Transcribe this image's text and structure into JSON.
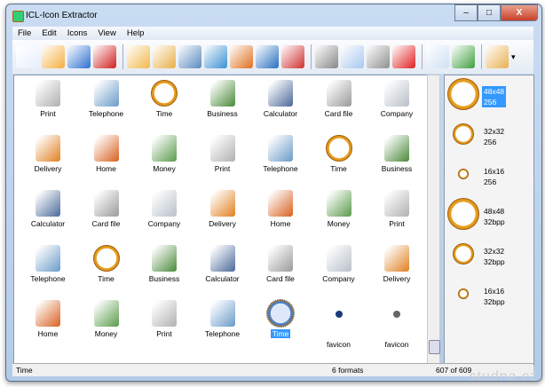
{
  "window": {
    "title": "ICL-Icon Extractor",
    "minimize": "–",
    "maximize": "□",
    "close": "X"
  },
  "menu": [
    "File",
    "Edit",
    "Icons",
    "View",
    "Help"
  ],
  "toolbar": [
    {
      "name": "new-icon",
      "color": "#e8f0fc"
    },
    {
      "name": "open-folder-icon",
      "color": "#f5b040"
    },
    {
      "name": "save-icon",
      "color": "#2f6fd0"
    },
    {
      "name": "save-ico-icon",
      "color": "#d02020"
    },
    "sep",
    {
      "name": "add-folder-icon",
      "color": "#f2b84a"
    },
    {
      "name": "search-folder-icon",
      "color": "#e8b048"
    },
    {
      "name": "search-screen-icon",
      "color": "#5a8ac0"
    },
    {
      "name": "web-search-icon",
      "color": "#3a90d0"
    },
    {
      "name": "extract-image-icon",
      "color": "#e07020"
    },
    {
      "name": "cubes-icon",
      "color": "#2a70c0"
    },
    {
      "name": "delete-image-icon",
      "color": "#d03030"
    },
    "sep",
    {
      "name": "cut-icon",
      "color": "#888888"
    },
    {
      "name": "copy-icon",
      "color": "#a8c8f0"
    },
    {
      "name": "paste-icon",
      "color": "#909090"
    },
    {
      "name": "delete-icon",
      "color": "#e02020"
    },
    "sep",
    {
      "name": "properties-icon",
      "color": "#d0e0f4"
    },
    {
      "name": "windows-icon",
      "color": "#40a040"
    },
    "sep",
    {
      "name": "resize-icon",
      "color": "#e8b050"
    }
  ],
  "icons": [
    {
      "label": "Print",
      "type": "print"
    },
    {
      "label": "Telephone",
      "type": "phone"
    },
    {
      "label": "Time",
      "type": "clock"
    },
    {
      "label": "Business",
      "type": "business"
    },
    {
      "label": "Calculator",
      "type": "calc"
    },
    {
      "label": "Card file",
      "type": "card"
    },
    {
      "label": "Company",
      "type": "company"
    },
    {
      "label": "Delivery",
      "type": "truck"
    },
    {
      "label": "Home",
      "type": "home"
    },
    {
      "label": "Money",
      "type": "money"
    },
    {
      "label": "Print",
      "type": "print"
    },
    {
      "label": "Telephone",
      "type": "phone"
    },
    {
      "label": "Time",
      "type": "clock"
    },
    {
      "label": "Business",
      "type": "business"
    },
    {
      "label": "Calculator",
      "type": "calc"
    },
    {
      "label": "Card file",
      "type": "card"
    },
    {
      "label": "Company",
      "type": "company"
    },
    {
      "label": "Delivery",
      "type": "truck"
    },
    {
      "label": "Home",
      "type": "home"
    },
    {
      "label": "Money",
      "type": "money"
    },
    {
      "label": "Print",
      "type": "print"
    },
    {
      "label": "Telephone",
      "type": "phone"
    },
    {
      "label": "Time",
      "type": "clock"
    },
    {
      "label": "Business",
      "type": "business"
    },
    {
      "label": "Calculator",
      "type": "calc"
    },
    {
      "label": "Card file",
      "type": "card"
    },
    {
      "label": "Company",
      "type": "company"
    },
    {
      "label": "Delivery",
      "type": "truck"
    },
    {
      "label": "Home",
      "type": "home"
    },
    {
      "label": "Money",
      "type": "money"
    },
    {
      "label": "Print",
      "type": "print"
    },
    {
      "label": "Telephone",
      "type": "phone"
    },
    {
      "label": "Time",
      "type": "clock",
      "selected": true
    },
    {
      "label": "favicon",
      "type": "fav1"
    },
    {
      "label": "favicon",
      "type": "fav2"
    }
  ],
  "formats": [
    {
      "size": "48x48",
      "depth": "256",
      "selected": true
    },
    {
      "size": "32x32",
      "depth": "256"
    },
    {
      "size": "16x16",
      "depth": "256"
    },
    {
      "size": "48x48",
      "depth": "32bpp"
    },
    {
      "size": "32x32",
      "depth": "32bpp"
    },
    {
      "size": "16x16",
      "depth": "32bpp"
    }
  ],
  "status": {
    "name": "Time",
    "formats": "6 formats",
    "count": "607 of 609"
  },
  "watermark": "studna.cz"
}
